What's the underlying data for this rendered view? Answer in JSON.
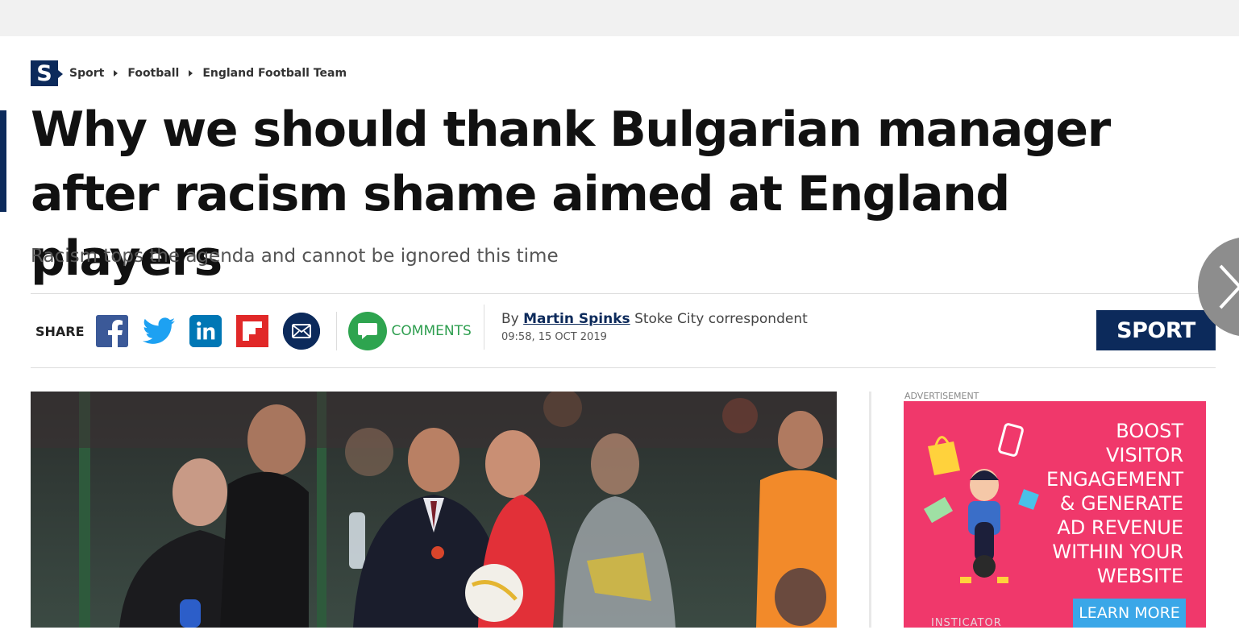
{
  "breadcrumb": {
    "logo_letter": "S",
    "items": [
      "Sport",
      "Football",
      "England Football Team"
    ]
  },
  "article": {
    "headline": "Why we should thank Bulgarian manager after racism shame aimed at England players",
    "standfirst": "Racism tops the agenda and cannot be ignored this time",
    "byline_prefix": "By",
    "author": "Martin Spinks",
    "author_role": "Stoke City correspondent",
    "date": "09:58, 15 OCT 2019",
    "section": "SPORT"
  },
  "share": {
    "label": "SHARE",
    "icons": [
      "facebook-icon",
      "twitter-icon",
      "linkedin-icon",
      "flipboard-icon",
      "email-icon"
    ],
    "comments_label": "COMMENTS"
  },
  "ad": {
    "label": "ADVERTISEMENT",
    "lines": [
      "BOOST",
      "VISITOR",
      "ENGAGEMENT",
      "& GENERATE",
      "AD REVENUE",
      "WITHIN YOUR",
      "WEBSITE"
    ],
    "cta": "LEARN MORE",
    "brand": "INSTICATOR"
  },
  "colors": {
    "brand_navy": "#0c2a5b",
    "comments_green": "#2ea44f",
    "ad_pink": "#f0386b",
    "ad_cta_blue": "#3aa7e8"
  }
}
